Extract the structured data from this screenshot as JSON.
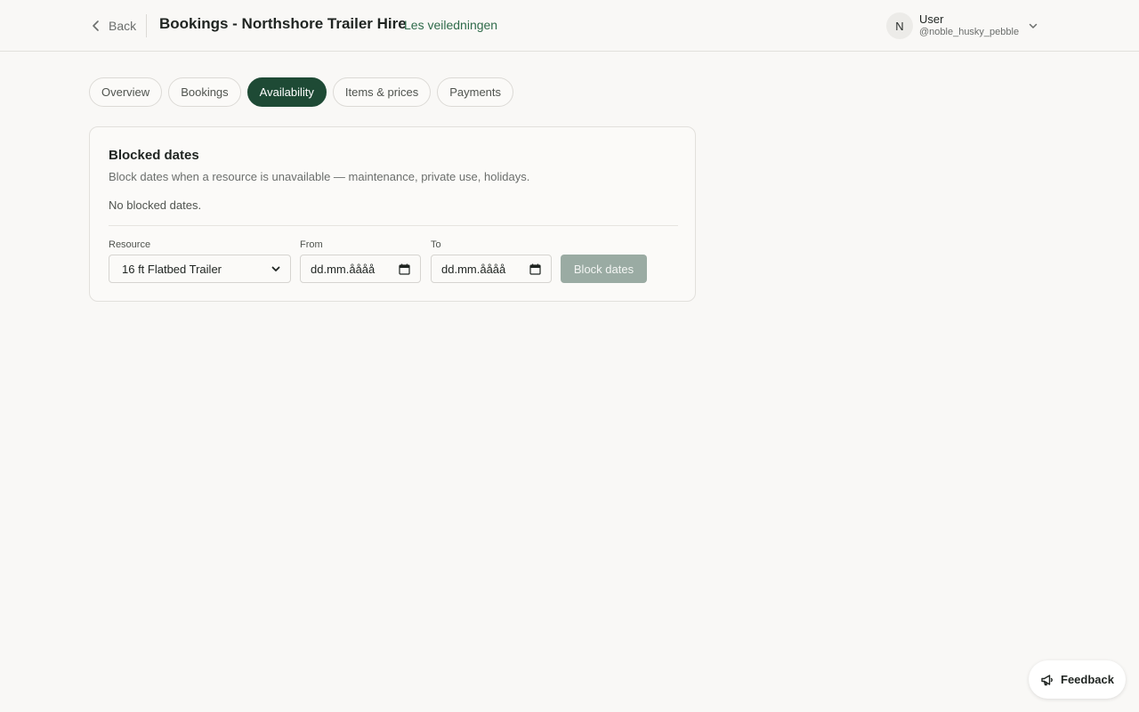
{
  "header": {
    "back_label": "Back",
    "title": "Bookings - Northshore Trailer Hire",
    "guides_link": "Les veiledningen",
    "user": {
      "initial": "N",
      "name": "User",
      "handle": "@noble_husky_pebble"
    }
  },
  "tabs": [
    {
      "label": "Overview",
      "active": false
    },
    {
      "label": "Bookings",
      "active": false
    },
    {
      "label": "Availability",
      "active": true
    },
    {
      "label": "Items & prices",
      "active": false
    },
    {
      "label": "Payments",
      "active": false
    }
  ],
  "blocked_dates": {
    "title": "Blocked dates",
    "description": "Block dates when a resource is unavailable — maintenance, private use, holidays.",
    "empty_text": "No blocked dates.",
    "resource_label": "Resource",
    "resource_value": "16 ft Flatbed Trailer",
    "from_label": "From",
    "from_placeholder": "dd.mm.åååå",
    "to_label": "To",
    "to_placeholder": "dd.mm.åååå",
    "submit_label": "Block dates"
  },
  "feedback_label": "Feedback",
  "colors": {
    "accent": "#1e4a35",
    "link": "#2f6b4a",
    "disabled_button": "#9aaba3",
    "background": "#f9f8f6"
  },
  "icons": {
    "back": "chevron-left-icon",
    "user_menu": "chevron-down-icon",
    "select": "chevron-down-icon",
    "date": "calendar-icon",
    "feedback": "megaphone-icon"
  }
}
